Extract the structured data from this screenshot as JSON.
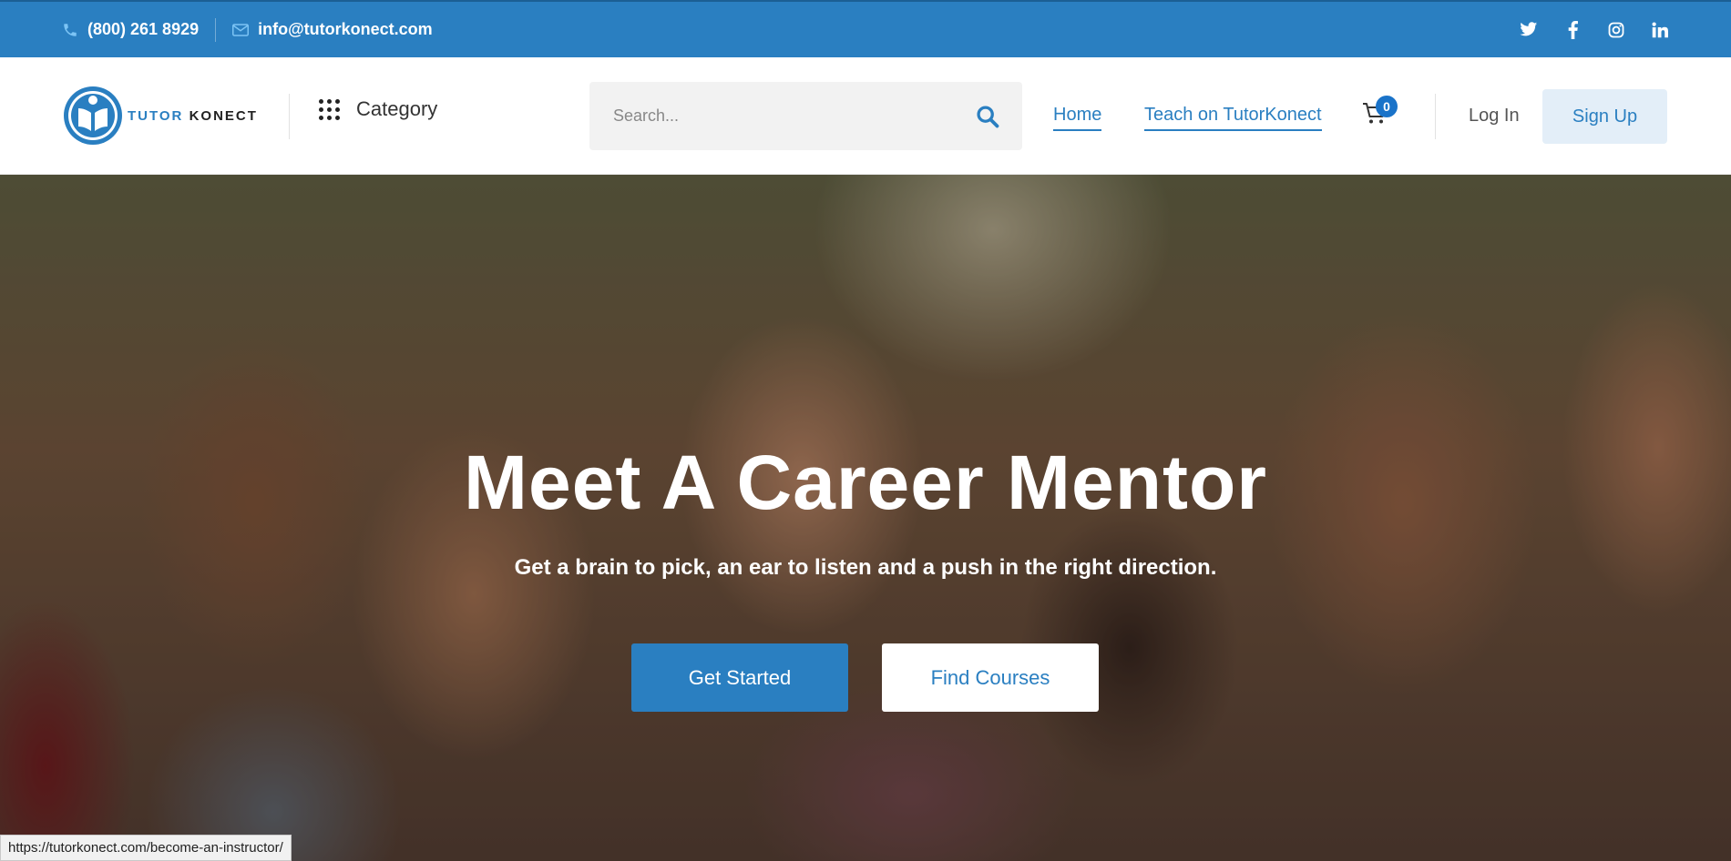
{
  "topbar": {
    "phone": "(800) 261 8929",
    "email": "info@tutorkonect.com",
    "social": [
      "twitter-icon",
      "facebook-icon",
      "instagram-icon",
      "linkedin-icon"
    ]
  },
  "header": {
    "logo_first": "TUTOR",
    "logo_second": "KONECT",
    "category_label": "Category",
    "search_placeholder": "Search...",
    "nav": {
      "home": "Home",
      "teach": "Teach on TutorKonect"
    },
    "cart_count": "0",
    "login": "Log In",
    "signup": "Sign Up"
  },
  "hero": {
    "title": "Meet A Career Mentor",
    "subtitle": "Get a brain to pick, an ear to listen and a push in the right direction.",
    "primary_button": "Get Started",
    "secondary_button": "Find Courses"
  },
  "status_url": "https://tutorkonect.com/become-an-instructor/",
  "colors": {
    "brand_blue": "#2a7fc1",
    "badge_blue": "#1a73c9",
    "signup_bg": "#e3eef8"
  }
}
